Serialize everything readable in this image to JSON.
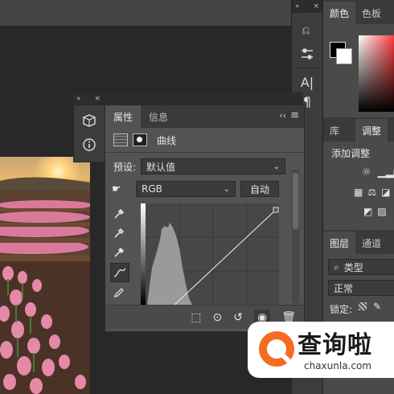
{
  "toolcol": {
    "collapse_glyph": "»",
    "close_glyph": "×"
  },
  "rightpanel": {
    "tabs_top": [
      "颜色",
      "色板"
    ],
    "tabs_mid": [
      "库",
      "调整"
    ],
    "adjust_label": "添加调整",
    "tabs_layers": [
      "图层",
      "通道"
    ],
    "kind_label": "类型",
    "blend_label": "正常",
    "lock_label": "锁定:"
  },
  "props": {
    "tabs": [
      "属性",
      "信息"
    ],
    "title": "曲线",
    "preset_label": "预设:",
    "preset_value": "默认值",
    "channel_value": "RGB",
    "auto_label": "自动",
    "menu_glyph": "≡",
    "collapse_glyph": "‹‹"
  },
  "watermark": {
    "title": "查询啦",
    "url": "chaxunla.com"
  },
  "colors": {
    "accent": "#f36c21",
    "panel": "#535353",
    "dark": "#2c2c2c"
  }
}
